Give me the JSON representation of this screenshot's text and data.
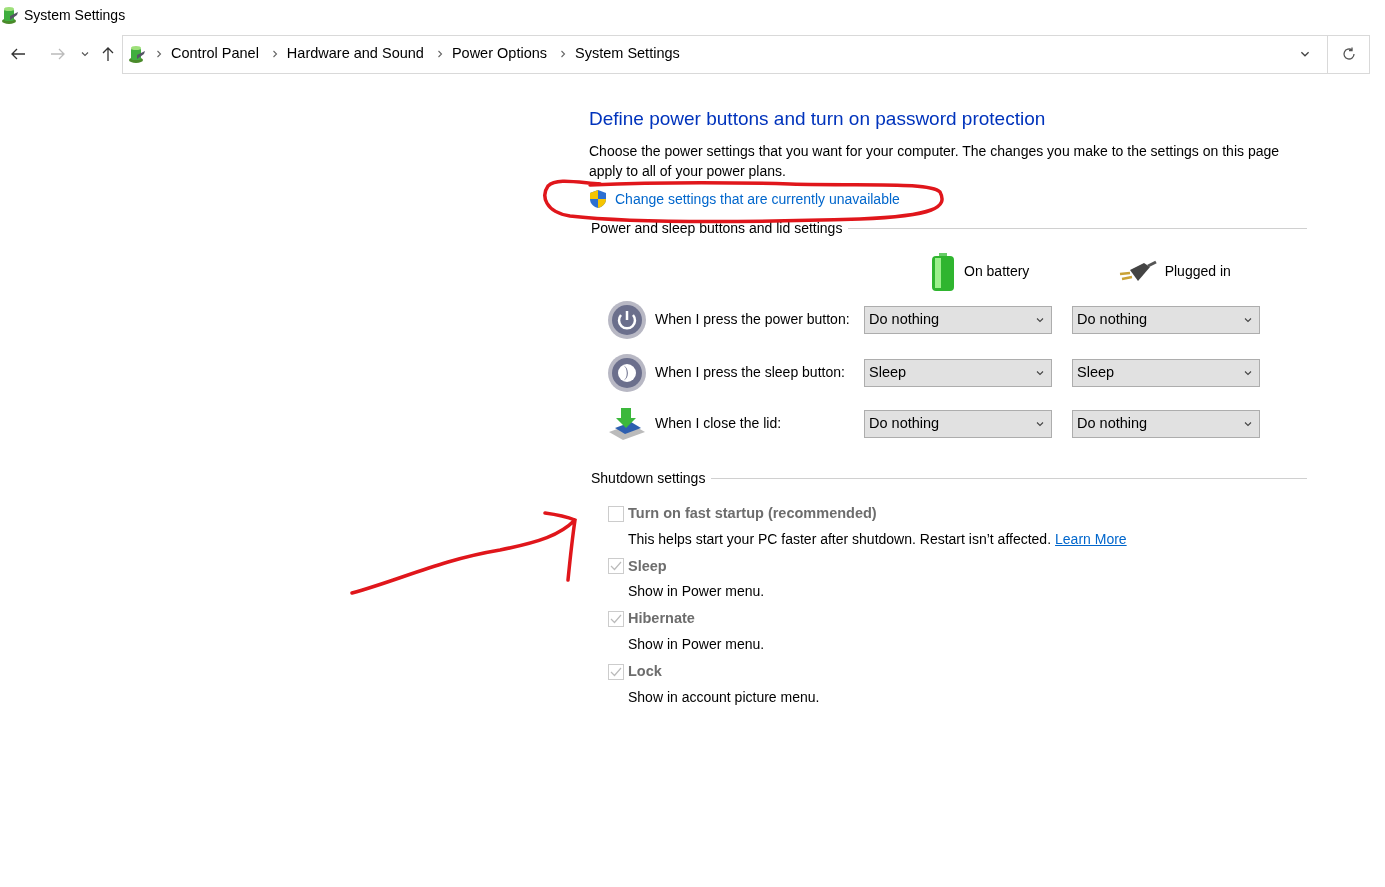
{
  "window": {
    "title": "System Settings"
  },
  "navigation": {
    "back_enabled": true,
    "forward_enabled": false
  },
  "breadcrumb": [
    "Control Panel",
    "Hardware and Sound",
    "Power Options",
    "System Settings"
  ],
  "page": {
    "heading": "Define power buttons and turn on password protection",
    "description": "Choose the power settings that you want for your computer. The changes you make to the settings on this page apply to all of your power plans.",
    "admin_link": "Change settings that are currently unavailable"
  },
  "buttons_section": {
    "title": "Power and sleep buttons and lid settings",
    "columns": [
      {
        "kind": "battery",
        "label": "On battery"
      },
      {
        "kind": "plug",
        "label": "Plugged in"
      }
    ],
    "rows": [
      {
        "kind": "power",
        "label": "When I press the power button:",
        "values": [
          "Do nothing",
          "Do nothing"
        ]
      },
      {
        "kind": "sleep",
        "label": "When I press the sleep button:",
        "values": [
          "Sleep",
          "Sleep"
        ]
      },
      {
        "kind": "lid",
        "label": "When I close the lid:",
        "values": [
          "Do nothing",
          "Do nothing"
        ]
      }
    ]
  },
  "shutdown_section": {
    "title": "Shutdown settings",
    "options": [
      {
        "label": "Turn on fast startup (recommended)",
        "checked": false,
        "disabled": true,
        "description": "This helps start your PC faster after shutdown. Restart isn’t affected.",
        "link": "Learn More"
      },
      {
        "label": "Sleep",
        "checked": true,
        "disabled": true,
        "description": "Show in Power menu."
      },
      {
        "label": "Hibernate",
        "checked": true,
        "disabled": true,
        "description": "Show in Power menu."
      },
      {
        "label": "Lock",
        "checked": true,
        "disabled": true,
        "description": "Show in account picture menu."
      }
    ]
  },
  "annotations": {
    "ellipse": {
      "color": "#e0161b"
    },
    "arrow": {
      "color": "#e0161b"
    }
  }
}
